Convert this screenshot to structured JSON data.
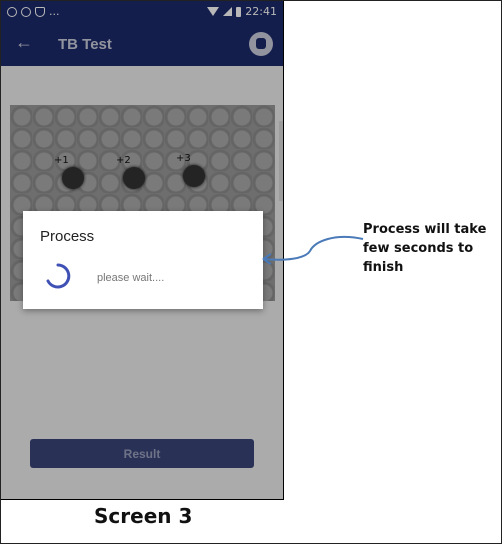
{
  "statusbar": {
    "time": "22:41",
    "ellipsis": "...",
    "icons_left": [
      "skype-icon",
      "notification-icon",
      "shield-icon"
    ],
    "icons_right": [
      "wifi-icon",
      "signal-icon",
      "battery-icon"
    ]
  },
  "appbar": {
    "title": "TB Test",
    "back_icon": "←"
  },
  "photo": {
    "spots": [
      {
        "label": "+1"
      },
      {
        "label": "+2"
      },
      {
        "label": "+3"
      }
    ]
  },
  "dialog": {
    "title": "Process",
    "message": "please wait....",
    "accent": "#3f51b5"
  },
  "actions": {
    "result_label": "Result"
  },
  "annotation": {
    "text": "Process will take few seconds to finish",
    "arrow_color": "#4a7ab8"
  },
  "caption": "Screen 3"
}
